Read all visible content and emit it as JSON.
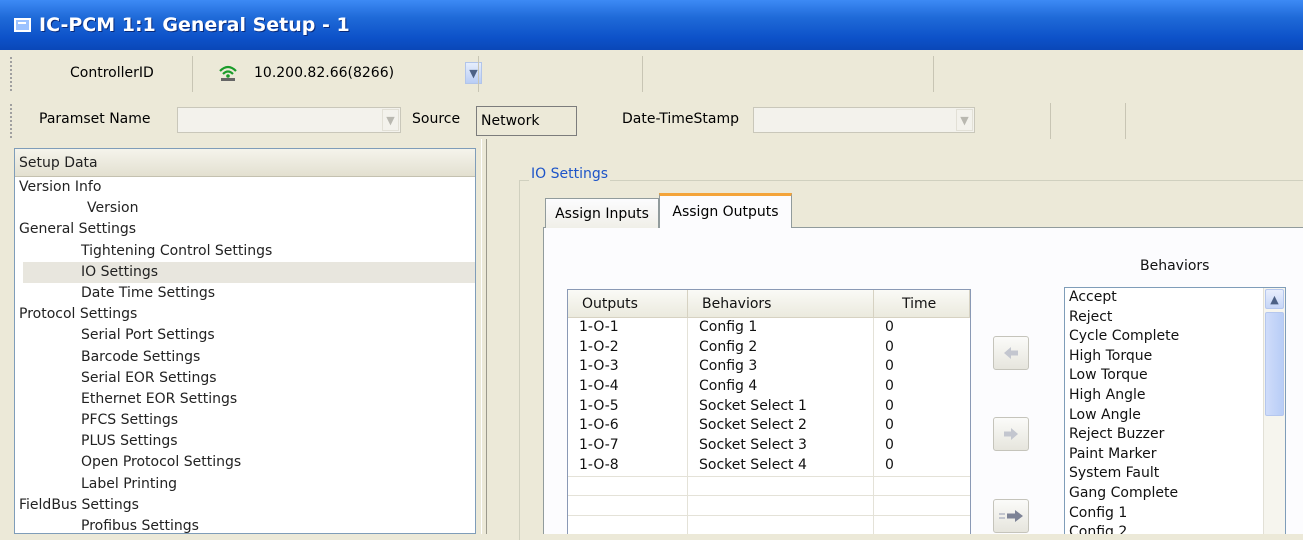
{
  "window": {
    "title": "IC-PCM 1:1 General Setup - 1"
  },
  "toolbar1": {
    "controller_label": "ControllerID",
    "controller_value": "10.200.82.66(8266)"
  },
  "toolbar2": {
    "paramset_label": "Paramset Name",
    "paramset_value": "",
    "source_label": "Source",
    "source_value": "Network",
    "datetime_label": "Date-TimeStamp",
    "datetime_value": ""
  },
  "tree": {
    "header": "Setup Data",
    "items": [
      {
        "label": "Version Info",
        "level": 0
      },
      {
        "label": "Version",
        "level": 2
      },
      {
        "label": "General Settings",
        "level": 0
      },
      {
        "label": "Tightening Control Settings",
        "level": 1
      },
      {
        "label": "IO Settings",
        "level": 1,
        "selected": true
      },
      {
        "label": "Date Time Settings",
        "level": 1
      },
      {
        "label": "Protocol Settings",
        "level": 0
      },
      {
        "label": "Serial Port Settings",
        "level": 1
      },
      {
        "label": "Barcode Settings",
        "level": 1
      },
      {
        "label": "Serial EOR Settings",
        "level": 1
      },
      {
        "label": "Ethernet EOR Settings",
        "level": 1
      },
      {
        "label": "PFCS Settings",
        "level": 1
      },
      {
        "label": "PLUS Settings",
        "level": 1
      },
      {
        "label": "Open Protocol Settings",
        "level": 1
      },
      {
        "label": "Label Printing",
        "level": 1
      },
      {
        "label": "FieldBus Settings",
        "level": 0
      },
      {
        "label": "Profibus Settings",
        "level": 1
      }
    ]
  },
  "io": {
    "group_title": "IO Settings",
    "tabs": [
      "Assign Inputs",
      "Assign Outputs"
    ],
    "active_tab": "Assign Outputs",
    "grid": {
      "columns": [
        "Outputs",
        "Behaviors",
        "Time"
      ],
      "rows": [
        [
          "1-O-1",
          "Config 1",
          "0"
        ],
        [
          "1-O-2",
          "Config 2",
          "0"
        ],
        [
          "1-O-3",
          "Config 3",
          "0"
        ],
        [
          "1-O-4",
          "Config 4",
          "0"
        ],
        [
          "1-O-5",
          "Socket Select 1",
          "0"
        ],
        [
          "1-O-6",
          "Socket Select 2",
          "0"
        ],
        [
          "1-O-7",
          "Socket Select 3",
          "0"
        ],
        [
          "1-O-8",
          "Socket Select 4",
          "0"
        ]
      ]
    },
    "behaviors_title": "Behaviors",
    "behaviors": [
      "Accept",
      "Reject",
      "Cycle Complete",
      "High Torque",
      "Low Torque",
      "High Angle",
      "Low Angle",
      "Reject Buzzer",
      "Paint Marker",
      "System Fault",
      "Gang Complete",
      "Config 1",
      "Config 2"
    ]
  },
  "icons": {
    "app": "window-icon",
    "network": "wifi-signal-icon",
    "dropdown": "chevron-down-icon",
    "move_left": "arrow-left-icon",
    "move_right": "arrow-right-icon",
    "move_all_right": "arrow-right-all-icon"
  }
}
